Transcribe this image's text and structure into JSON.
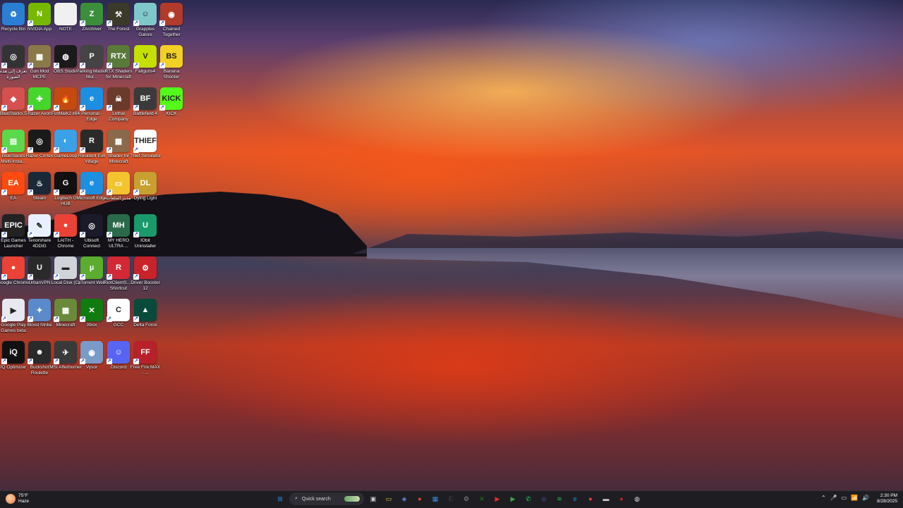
{
  "desktop": {
    "icons": [
      {
        "label": "Recycle Bin",
        "icon": "recycle-bin-icon",
        "color": "#2a7fd4",
        "glyph": "♻"
      },
      {
        "label": "NVIDIA App",
        "icon": "nvidia-icon",
        "color": "#76b900",
        "glyph": "N"
      },
      {
        "label": "NOTE",
        "icon": "document-icon",
        "color": "#f0f0f0",
        "glyph": ""
      },
      {
        "label": "ZArchiver",
        "icon": "zarchiver-icon",
        "color": "#3b8f3b",
        "glyph": "Z"
      },
      {
        "label": "The Forest",
        "icon": "forest-icon",
        "color": "#3b3a2a",
        "glyph": "⚒"
      },
      {
        "label": "Grapples Galore",
        "icon": "grapples-galore-icon",
        "color": "#7fc7c9",
        "glyph": "☺"
      },
      {
        "label": "Chained Together",
        "icon": "chained-together-icon",
        "color": "#b23a2a",
        "glyph": "◉"
      },
      {
        "label": "تعرف إلى هذه الصورة",
        "icon": "learn-picture-icon",
        "color": "#333333",
        "glyph": "◎"
      },
      {
        "label": "Gun Mod MCPE",
        "icon": "gun-mod-icon",
        "color": "#8a7a4a",
        "glyph": "▦"
      },
      {
        "label": "OBS Studio",
        "icon": "obs-studio-icon",
        "color": "#1a1a1a",
        "glyph": "◍"
      },
      {
        "label": "Parking Master Mul...",
        "icon": "parking-master-icon",
        "color": "#444444",
        "glyph": "P"
      },
      {
        "label": "RTX Shaders for Minecraft",
        "icon": "rtx-shaders-icon",
        "color": "#5a7a3a",
        "glyph": "RTX"
      },
      {
        "label": "Fallguns4",
        "icon": "fallguns-icon",
        "color": "#c4e000",
        "glyph": "V"
      },
      {
        "label": "Banana Shooter",
        "icon": "banana-shooter-icon",
        "color": "#f2d024",
        "glyph": "BS"
      },
      {
        "label": "BlueStacks 5",
        "icon": "bluestacks-icon",
        "color": "#d65050",
        "glyph": "◆"
      },
      {
        "label": "Razer Axon",
        "icon": "razer-axon-icon",
        "color": "#44d62c",
        "glyph": "✚"
      },
      {
        "label": "FurMark2 x64",
        "icon": "furmark-icon",
        "color": "#c44a10",
        "glyph": "🔥"
      },
      {
        "label": "Personal - Edge",
        "icon": "edge-personal-icon",
        "color": "#1d8fe0",
        "glyph": "e"
      },
      {
        "label": "Lethal Company",
        "icon": "lethal-company-icon",
        "color": "#6a3a2a",
        "glyph": "☠"
      },
      {
        "label": "Battlefield 4",
        "icon": "battlefield-icon",
        "color": "#3a3a3a",
        "glyph": "BF"
      },
      {
        "label": "KICK",
        "icon": "kick-icon",
        "color": "#53fc18",
        "glyph": "KICK"
      },
      {
        "label": "BlueStacks Multi-Insta...",
        "icon": "bluestacks-multi-icon",
        "color": "#5ad94a",
        "glyph": "▤"
      },
      {
        "label": "Razer Cortex",
        "icon": "razer-cortex-icon",
        "color": "#1a1a1a",
        "glyph": "◎"
      },
      {
        "label": "GameLoop",
        "icon": "gameloop-icon",
        "color": "#3aa0e8",
        "glyph": "◐"
      },
      {
        "label": "Resident Evil Village",
        "icon": "resident-evil-icon",
        "color": "#2a2a2a",
        "glyph": "R"
      },
      {
        "label": "Shader for Minecraft",
        "icon": "shader-minecraft-icon",
        "color": "#8a6a4a",
        "glyph": "▦"
      },
      {
        "label": "Thief Simulator",
        "icon": "thief-simulator-icon",
        "color": "#ffffff",
        "glyph": "THIEF"
      },
      {
        "label": "EA",
        "icon": "ea-icon",
        "color": "#ff4a12",
        "glyph": "EA"
      },
      {
        "label": "Steam",
        "icon": "steam-icon",
        "color": "#1b2838",
        "glyph": "♨"
      },
      {
        "label": "Logitech G HUB",
        "icon": "logitech-ghub-icon",
        "color": "#111111",
        "glyph": "G"
      },
      {
        "label": "Microsoft Edge",
        "icon": "edge-icon",
        "color": "#1d8fe0",
        "glyph": "e"
      },
      {
        "label": "مدير الملفات",
        "icon": "file-manager-icon",
        "color": "#f4c430",
        "glyph": "▭"
      },
      {
        "label": "Dying Light",
        "icon": "dying-light-icon",
        "color": "#c8a030",
        "glyph": "DL"
      },
      {
        "label": "Epic Games Launcher",
        "icon": "epic-games-icon",
        "color": "#222222",
        "glyph": "EPIC"
      },
      {
        "label": "Tenorshare 4DDiG",
        "icon": "tenorshare-icon",
        "color": "#e8f0ff",
        "glyph": "✎"
      },
      {
        "label": "LAITH - Chrome",
        "icon": "chrome-profile-icon",
        "color": "#ea4335",
        "glyph": "●"
      },
      {
        "label": "Ubisoft Connect",
        "icon": "ubisoft-icon",
        "color": "#1a1a2a",
        "glyph": "◎"
      },
      {
        "label": "MY HERO ULTRA ...",
        "icon": "my-hero-icon",
        "color": "#2a6a4a",
        "glyph": "MH"
      },
      {
        "label": "IObit Uninstaller",
        "icon": "iobit-icon",
        "color": "#1a9a6a",
        "glyph": "U"
      },
      {
        "label": "Google Chrome",
        "icon": "chrome-icon",
        "color": "#ea4335",
        "glyph": "●"
      },
      {
        "label": "UrbanVPN",
        "icon": "urbanvpn-icon",
        "color": "#2a2a2a",
        "glyph": "U"
      },
      {
        "label": "Local Disk (C)",
        "icon": "local-disk-icon",
        "color": "#d0d4da",
        "glyph": "▬"
      },
      {
        "label": "uTorrent Web",
        "icon": "utorrent-icon",
        "color": "#5aad2e",
        "glyph": "µ"
      },
      {
        "label": "RiotClientS... - Shortcut",
        "icon": "riot-client-icon",
        "color": "#d32936",
        "glyph": "R"
      },
      {
        "label": "Driver Booster 12",
        "icon": "driver-booster-icon",
        "color": "#c8222a",
        "glyph": "⚙"
      },
      {
        "label": "Google Play Games beta",
        "icon": "play-games-icon",
        "color": "#e8e8f0",
        "glyph": "▶"
      },
      {
        "label": "Blood Strike",
        "icon": "blood-strike-icon",
        "color": "#5a8aca",
        "glyph": "✦"
      },
      {
        "label": "Minecraft",
        "icon": "minecraft-icon",
        "color": "#6a8a3a",
        "glyph": "▦"
      },
      {
        "label": "Xbox",
        "icon": "xbox-icon",
        "color": "#107c10",
        "glyph": "✕"
      },
      {
        "label": "GCC",
        "icon": "gcc-icon",
        "color": "#ffffff",
        "glyph": "C"
      },
      {
        "label": "Delta Force",
        "icon": "delta-force-icon",
        "color": "#0a4a3a",
        "glyph": "▲"
      },
      {
        "label": "IQ Optimizer",
        "icon": "iq-optimizer-icon",
        "color": "#111111",
        "glyph": "iQ"
      },
      {
        "label": "Buckshot Roulette",
        "icon": "buckshot-roulette-icon",
        "color": "#2a2a2a",
        "glyph": "☻"
      },
      {
        "label": "MSI Afterburner",
        "icon": "msi-afterburner-icon",
        "color": "#3a3a3a",
        "glyph": "✈"
      },
      {
        "label": "Vysor",
        "icon": "vysor-icon",
        "color": "#7a9ac8",
        "glyph": "◉"
      },
      {
        "label": "Discord",
        "icon": "discord-icon",
        "color": "#5865f2",
        "glyph": "☺"
      },
      {
        "label": "Free Fire MAX - ...",
        "icon": "free-fire-icon",
        "color": "#b8202a",
        "glyph": "FF"
      }
    ]
  },
  "taskbar": {
    "weather": {
      "temp": "75°F",
      "condition": "Haze"
    },
    "search_placeholder": "Quick search",
    "apps": [
      {
        "name": "start-button",
        "glyph": "⊞",
        "color": "#2a8ae8"
      },
      {
        "name": "task-view-icon",
        "glyph": "▣",
        "color": "#cccccc"
      },
      {
        "name": "file-explorer-icon",
        "glyph": "▭",
        "color": "#f4c430"
      },
      {
        "name": "copilot-icon",
        "glyph": "◈",
        "color": "#6a8ae8"
      },
      {
        "name": "chrome-taskbar-icon",
        "glyph": "●",
        "color": "#ea4335"
      },
      {
        "name": "store-icon",
        "glyph": "▦",
        "color": "#3a8ae8"
      },
      {
        "name": "epic-taskbar-icon",
        "glyph": "E",
        "color": "#444444"
      },
      {
        "name": "settings-taskbar-icon",
        "glyph": "⚙",
        "color": "#888888"
      },
      {
        "name": "xbox-taskbar-icon",
        "glyph": "✕",
        "color": "#107c10"
      },
      {
        "name": "youtube-icon",
        "glyph": "▶",
        "color": "#e52d27"
      },
      {
        "name": "play-taskbar-icon",
        "glyph": "▶",
        "color": "#3aa84a"
      },
      {
        "name": "whatsapp-icon",
        "glyph": "✆",
        "color": "#25d366"
      },
      {
        "name": "discord-taskbar-icon",
        "glyph": "☺",
        "color": "#5865f2"
      },
      {
        "name": "spotify-icon",
        "glyph": "≋",
        "color": "#1db954"
      },
      {
        "name": "edge-taskbar-icon",
        "glyph": "e",
        "color": "#1d8fe0"
      },
      {
        "name": "chrome-profile-taskbar-icon",
        "glyph": "●",
        "color": "#ea4335"
      },
      {
        "name": "keyboard-taskbar-icon",
        "glyph": "▬",
        "color": "#cccccc"
      },
      {
        "name": "record-icon",
        "glyph": "●",
        "color": "#c8222a"
      },
      {
        "name": "obs-taskbar-icon",
        "glyph": "◍",
        "color": "#dddddd"
      }
    ],
    "tray": [
      "⌃",
      "🎤",
      "▭",
      "📶",
      "🔊"
    ],
    "time": "2:30 PM",
    "date": "8/28/2025"
  }
}
